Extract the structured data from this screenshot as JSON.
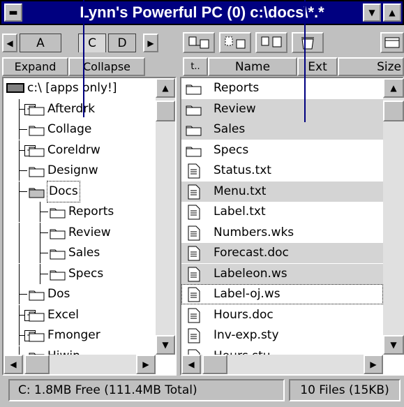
{
  "window": {
    "title": "Lynn's Powerful PC (0) c:\\docs\\*.*"
  },
  "drive_tabs": [
    "A",
    "C",
    "D"
  ],
  "tree_buttons": {
    "expand": "Expand",
    "collapse": "Collapse"
  },
  "tree": {
    "root": "c:\\ [apps only!]",
    "items": [
      {
        "label": "Afterdrk",
        "level": 1,
        "expand": "+",
        "selected": false
      },
      {
        "label": "Collage",
        "level": 1,
        "expand": "",
        "selected": false
      },
      {
        "label": "Coreldrw",
        "level": 1,
        "expand": "+",
        "selected": false
      },
      {
        "label": "Designw",
        "level": 1,
        "expand": "",
        "selected": false
      },
      {
        "label": "Docs",
        "level": 1,
        "expand": "",
        "selected": true,
        "open": true
      },
      {
        "label": "Reports",
        "level": 2,
        "expand": "",
        "selected": false
      },
      {
        "label": "Review",
        "level": 2,
        "expand": "",
        "selected": false
      },
      {
        "label": "Sales",
        "level": 2,
        "expand": "",
        "selected": false
      },
      {
        "label": "Specs",
        "level": 2,
        "expand": "",
        "selected": false
      },
      {
        "label": "Dos",
        "level": 1,
        "expand": "",
        "selected": false
      },
      {
        "label": "Excel",
        "level": 1,
        "expand": "+",
        "selected": false
      },
      {
        "label": "Fmonger",
        "level": 1,
        "expand": "+",
        "selected": false
      },
      {
        "label": "Hiwin",
        "level": 1,
        "expand": "",
        "selected": false
      }
    ]
  },
  "file_headers": {
    "sort": "t..",
    "name": "Name",
    "ext": "Ext",
    "size": "Size"
  },
  "files": [
    {
      "name": "Reports",
      "type": "folder",
      "highlight": false
    },
    {
      "name": "Review",
      "type": "folder",
      "highlight": true
    },
    {
      "name": "Sales",
      "type": "folder",
      "highlight": true
    },
    {
      "name": "Specs",
      "type": "folder",
      "highlight": false
    },
    {
      "name": "Status.txt",
      "type": "file",
      "highlight": false
    },
    {
      "name": "Menu.txt",
      "type": "file",
      "highlight": true
    },
    {
      "name": "Label.txt",
      "type": "file",
      "highlight": false
    },
    {
      "name": "Numbers.wks",
      "type": "file",
      "highlight": false
    },
    {
      "name": "Forecast.doc",
      "type": "file",
      "highlight": true
    },
    {
      "name": "Labeleon.ws",
      "type": "file",
      "highlight": true
    },
    {
      "name": "Label-oj.ws",
      "type": "file",
      "highlight": false,
      "focused": true
    },
    {
      "name": "Hours.doc",
      "type": "file",
      "highlight": false
    },
    {
      "name": "Inv-exp.sty",
      "type": "file",
      "highlight": false
    },
    {
      "name": "Hours.stu",
      "type": "file",
      "highlight": false
    }
  ],
  "status": {
    "drive": "C: 1.8MB Free (111.4MB Total)",
    "files": "10 Files (15KB)"
  }
}
